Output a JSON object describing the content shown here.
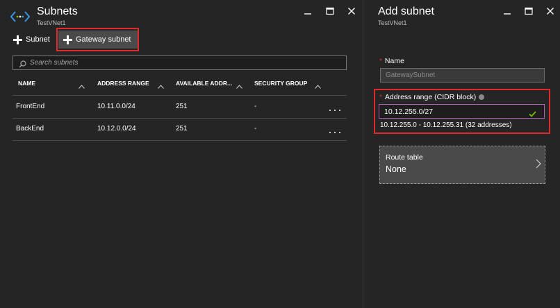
{
  "subnets_blade": {
    "title": "Subnets",
    "subtitle": "TestVNet1",
    "icon": "virtual-network-icon",
    "controls": [
      "pin-icon",
      "maximize-icon",
      "close-icon"
    ],
    "toolbar": {
      "add_subnet_label": "Subnet",
      "add_gateway_subnet_label": "Gateway subnet"
    },
    "search": {
      "placeholder": "Search subnets",
      "value": ""
    },
    "table": {
      "columns": [
        "NAME",
        "ADDRESS RANGE",
        "AVAILABLE ADDR...",
        "SECURITY GROUP"
      ],
      "rows": [
        {
          "name": "FrontEnd",
          "address_range": "10.11.0.0/24",
          "available": "251",
          "security_group": "-"
        },
        {
          "name": "BackEnd",
          "address_range": "10.12.0.0/24",
          "available": "251",
          "security_group": "-"
        }
      ]
    }
  },
  "add_subnet_blade": {
    "title": "Add subnet",
    "subtitle": "TestVNet1",
    "controls": [
      "pin-icon",
      "maximize-icon",
      "close-icon"
    ],
    "name_field": {
      "label": "Name",
      "required_mark": "*",
      "value": "GatewaySubnet"
    },
    "address_range_field": {
      "label": "Address range (CIDR block)",
      "required_mark": "*",
      "value": "10.12.255.0/27",
      "hint": "10.12.255.0 - 10.12.255.31 (32 addresses)"
    },
    "route_table": {
      "label": "Route table",
      "value": "None"
    }
  },
  "colors": {
    "background": "#252526",
    "highlight": "#e02b2b",
    "accent_blue": "#3a96dd",
    "valid_green": "#7fba00",
    "focus_border": "#b25db6"
  }
}
